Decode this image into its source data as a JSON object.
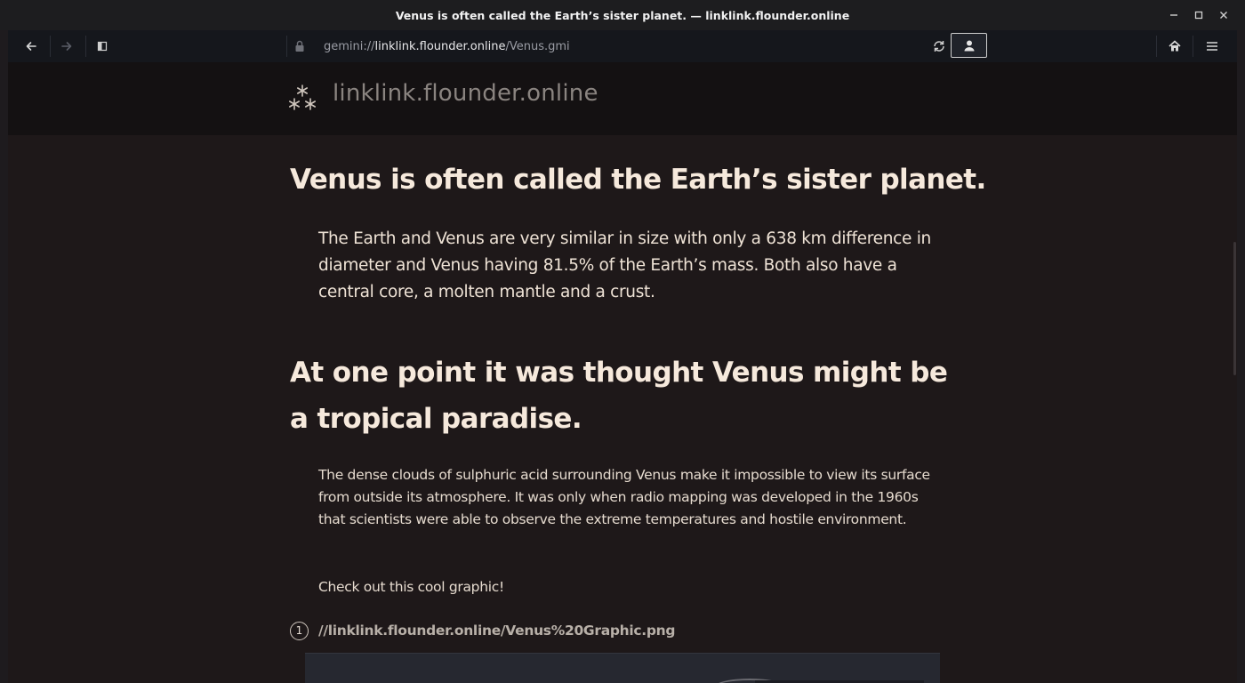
{
  "window": {
    "title": "Venus is often called the Earth’s sister planet. — linklink.flounder.online"
  },
  "toolbar": {
    "url_scheme": "gemini://",
    "url_host": "linklink.flounder.online",
    "url_path": "/Venus.gmi"
  },
  "banner": {
    "site_name": "linklink.flounder.online",
    "logo_glyph": "⁂"
  },
  "article": {
    "heading1": "Venus is often called the Earth’s sister planet.",
    "paragraph1": "The Earth and Venus are very similar in size with only a 638 km difference in diameter and Venus having 81.5% of the Earth’s mass. Both also have a central core, a molten mantle and a crust.",
    "heading2": "At one point it was thought Venus might be a tropical paradise.",
    "paragraph2": "The dense clouds of sulphuric acid surrounding Venus make it impossible to view its surface from outside its atmosphere. It was only when radio mapping was developed in the 1960s that scientists were able to observe the extreme temperatures and hostile environment.",
    "paragraph3": "Check out this cool graphic!",
    "link": {
      "number": "1",
      "text": "//linklink.flounder.online/Venus%20Graphic.png"
    }
  },
  "icons": {
    "back": "back-arrow-icon",
    "forward": "forward-arrow-icon",
    "sidebar": "sidebar-icon",
    "lock": "lock-icon",
    "reload": "reload-icon",
    "identity": "person-icon",
    "home": "home-icon",
    "menu": "hamburger-menu-icon"
  },
  "colors": {
    "background": "#1e1819",
    "heading": "#f6e9dc",
    "text": "#efe3d6",
    "link": "#b8b0a8"
  }
}
